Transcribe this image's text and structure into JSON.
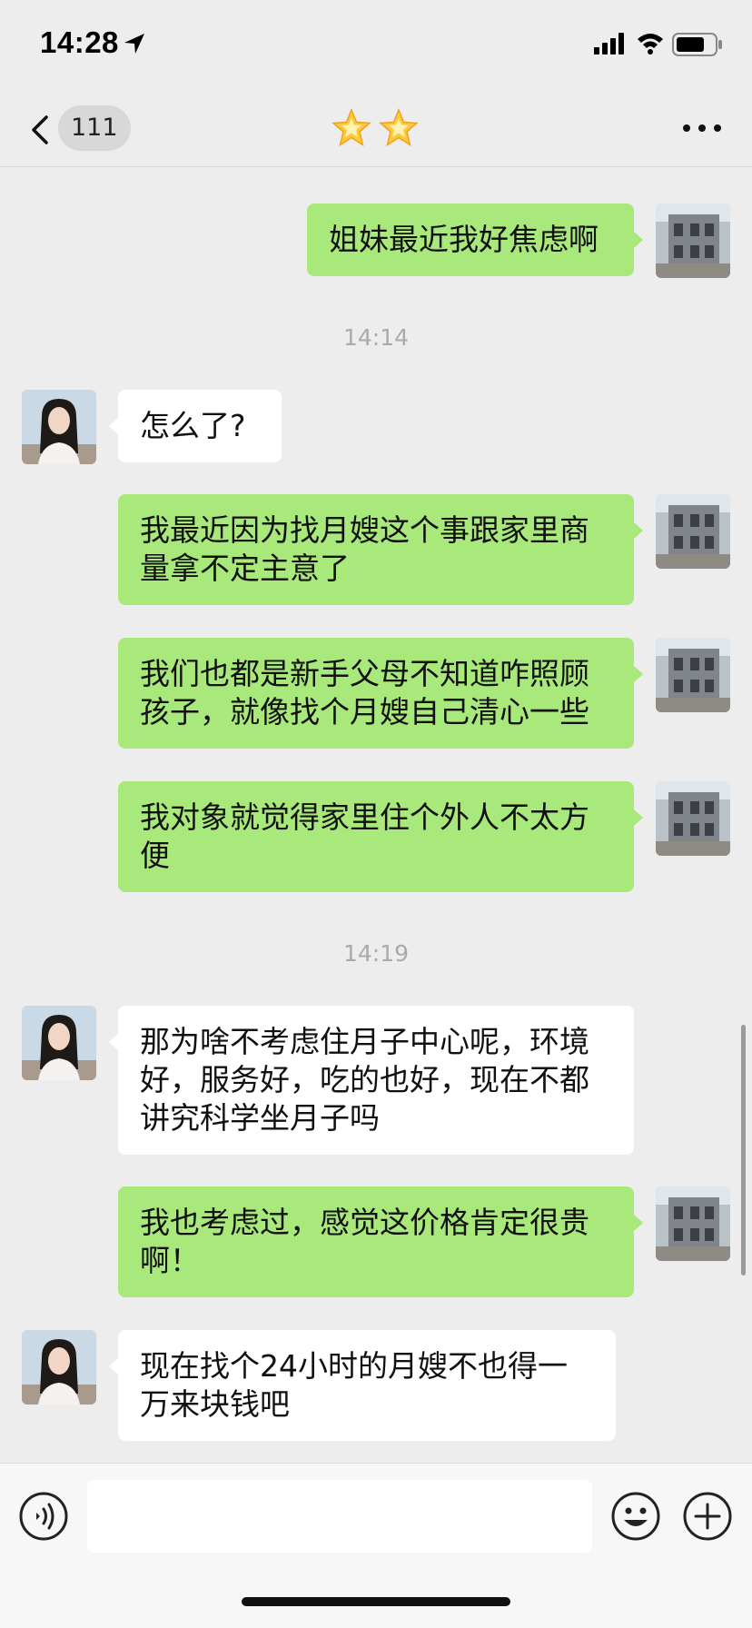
{
  "status_bar": {
    "time": "14:28",
    "icons": [
      "location-arrow-icon",
      "cellular-signal-icon",
      "wifi-icon",
      "battery-icon"
    ]
  },
  "nav": {
    "back_icon": "chevron-left-icon",
    "unread_count": "111",
    "title_icons": [
      "star-icon",
      "star-icon"
    ],
    "more_icon": "more-dots-icon"
  },
  "chat": {
    "timestamps": [
      "14:14",
      "14:19"
    ],
    "messages": [
      {
        "side": "out",
        "text": "姐妹最近我好焦虑啊"
      },
      {
        "side": "in",
        "text": "怎么了?"
      },
      {
        "side": "out",
        "text": "我最近因为找月嫂这个事跟家里商\n量拿不定主意了"
      },
      {
        "side": "out",
        "text": "我们也都是新手父母不知道咋照顾\n孩子，就像找个月嫂自己清心一些"
      },
      {
        "side": "out",
        "text": "我对象就觉得家里住个外人不太方\n便"
      },
      {
        "side": "in",
        "text": "那为啥不考虑住月子中心呢，环境\n好，服务好，吃的也好，现在不都\n讲究科学坐月子吗"
      },
      {
        "side": "out",
        "text": "我也考虑过，感觉这价格肯定很贵\n啊！"
      },
      {
        "side": "in",
        "text": "现在找个24小时的月嫂不也得一\n万来块钱吧"
      }
    ]
  },
  "input_bar": {
    "message_value": "",
    "icons": [
      "voice-icon",
      "emoji-icon",
      "plus-icon"
    ]
  },
  "colors": {
    "background": "#ededed",
    "outgoing_bubble": "#a9e87a",
    "incoming_bubble": "#ffffff",
    "timestamp": "#aaaaaa"
  }
}
